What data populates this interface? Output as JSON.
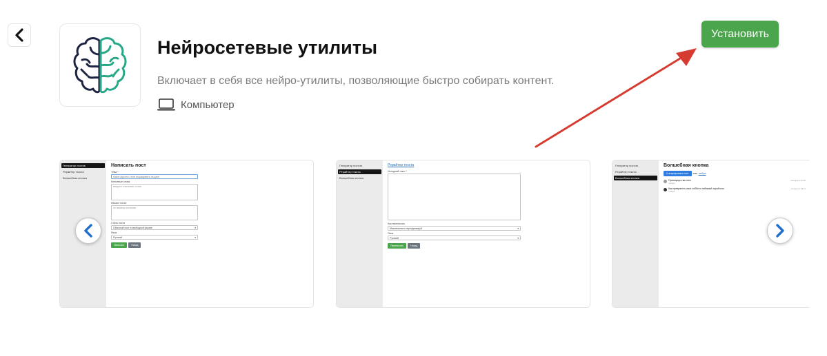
{
  "header": {
    "back_icon": "chevron-left-icon",
    "app_icon": "brain-icon",
    "title": "Нейросетевые утилиты",
    "description": "Включает в себя все нейро-утилиты, позволяющие быстро собирать контент.",
    "platform_icon": "laptop-icon",
    "platform_label": "Компьютер",
    "install_label": "Установить"
  },
  "colors": {
    "install": "#4aa54c",
    "arrow": "#d63b31",
    "nav_chevron": "#1f6fd1"
  },
  "carousel": {
    "prev_icon": "chevron-left-icon",
    "next_icon": "chevron-right-icon",
    "shot1": {
      "menu": [
        "Генератор постов",
        "Рерайтер текста",
        "Волшебная кнопка"
      ],
      "title": "Написать пост",
      "topic_label": "Тема *",
      "topic_value": "Какие фрукты стоит выращивать на даче",
      "keywords_label": "Ключевые слова",
      "keywords_placeholder": "введите ключевые слова",
      "start_label": "Начало поста",
      "start_placeholder": "по вашему желанию",
      "style_label": "Стиль поста",
      "style_value": "Обычный пост в свободной форме",
      "lang_label": "Язык",
      "lang_value": "Русский",
      "primary_btn": "Написать",
      "secondary_btn": "Назад"
    },
    "shot2": {
      "menu": [
        "Генератор постов",
        "Рерайтер текста",
        "Волшебная кнопка"
      ],
      "title": "Рерайтер текста",
      "source_label": "Исходный текст *",
      "mode_label": "Как переписать",
      "mode_value": "Максимально перефразируй",
      "lang_label": "Язык",
      "lang_value": "Русский",
      "primary_btn": "Переписать",
      "secondary_btn": "Назад"
    },
    "shot3": {
      "menu": [
        "Генератор постов",
        "Рерайтер текста",
        "Волшебная кнопка"
      ],
      "title": "Волшебная кнопка",
      "action_btn": "Сгенерировать пост",
      "or_text": "или",
      "or_link": "любую",
      "feed": [
        {
          "title": "Преимущества пчел",
          "sub": "любую",
          "date": "сегодня в 10:20"
        },
        {
          "title": "Как превратить свое хобби в любимый заработок",
          "sub": "любую",
          "date": "сегодня в 10:11"
        }
      ]
    }
  }
}
